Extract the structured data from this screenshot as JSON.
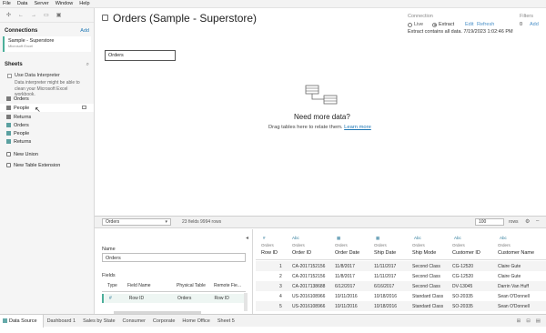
{
  "menu": [
    "File",
    "Data",
    "Server",
    "Window",
    "Help"
  ],
  "toolbar": {
    "icons": [
      "tableau-logo-icon",
      "back-icon",
      "forward-icon",
      "save-icon",
      "present-icon"
    ]
  },
  "connections": {
    "title": "Connections",
    "add_label": "Add",
    "item": {
      "name": "Sample - Superstore",
      "type": "Microsoft Excel"
    }
  },
  "sheets": {
    "title": "Sheets",
    "use_interpreter_label": "Use Data Interpreter",
    "interpreter_note": "Data interpreter might be able to clean your Microsoft Excel workbook.",
    "items": [
      "Orders",
      "People",
      "Returns",
      "Orders",
      "People",
      "Returns"
    ],
    "new_union": "New Union",
    "new_table_extension": "New Table Extension"
  },
  "header": {
    "title": "Orders (Sample - Superstore)",
    "connection_label": "Connection",
    "live_label": "Live",
    "extract_label": "Extract",
    "edit_label": "Edit",
    "refresh_label": "Refresh",
    "extract_note": "Extract contains all data. 7/19/2023 1:02:46 PM",
    "filters_label": "Filters",
    "filters_count": "0",
    "filters_add": "Add"
  },
  "canvas": {
    "table_card": "Orders",
    "need_data_title": "Need more data?",
    "need_data_sub": "Drag tables here to relate them.",
    "learn_more": "Learn more"
  },
  "grid_toolbar": {
    "table_select": "Orders",
    "field_count": "23 fields 9994 rows",
    "rows_value": "100",
    "rows_label": "rows"
  },
  "metadata": {
    "name_label": "Name",
    "name_value": "Orders",
    "fields_label": "Fields",
    "columns": [
      "Type",
      "Field Name",
      "Physical Table",
      "Remote Fie..."
    ],
    "row": {
      "type": "#",
      "field_name": "Row ID",
      "physical_table": "Orders",
      "remote_field": "Row ID"
    }
  },
  "grid": {
    "columns": [
      {
        "type": "#",
        "source": "Orders",
        "name": "Row ID"
      },
      {
        "type": "Abc",
        "source": "Orders",
        "name": "Order ID"
      },
      {
        "type": "date-icon",
        "source": "Orders",
        "name": "Order Date"
      },
      {
        "type": "date-icon",
        "source": "Orders",
        "name": "Ship Date"
      },
      {
        "type": "Abc",
        "source": "Orders",
        "name": "Ship Mode"
      },
      {
        "type": "Abc",
        "source": "Orders",
        "name": "Customer ID"
      },
      {
        "type": "Abc",
        "source": "Orders",
        "name": "Customer Name"
      }
    ],
    "rows": [
      [
        "1",
        "CA-2017152156",
        "11/8/2017",
        "11/11/2017",
        "Second Class",
        "CG-12520",
        "Claire Gute"
      ],
      [
        "2",
        "CA-2017152156",
        "11/8/2017",
        "11/11/2017",
        "Second Class",
        "CG-12520",
        "Claire Gute"
      ],
      [
        "3",
        "CA-2017138688",
        "6/12/2017",
        "6/16/2017",
        "Second Class",
        "DV-13045",
        "Darrin Van Huff"
      ],
      [
        "4",
        "US-2016108966",
        "10/11/2016",
        "10/18/2016",
        "Standard Class",
        "SO-20335",
        "Sean O'Donnell"
      ],
      [
        "5",
        "US-2016108966",
        "10/11/2016",
        "10/18/2016",
        "Standard Class",
        "SO-20335",
        "Sean O'Donnell"
      ]
    ]
  },
  "tabs": {
    "data_source": "Data Source",
    "sheets": [
      "Dashboard 1",
      "Sales by State",
      "Consumer",
      "Corporate",
      "Home Office",
      "Sheet 5"
    ]
  }
}
